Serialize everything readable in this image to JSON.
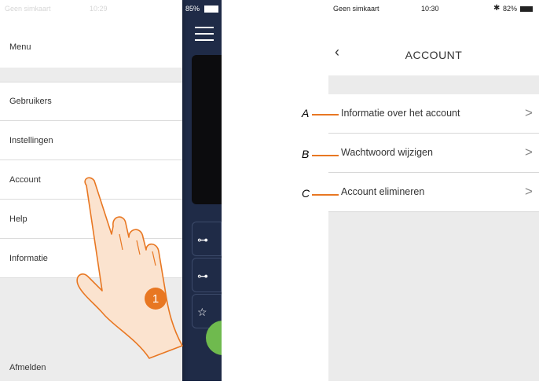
{
  "left_phone": {
    "status_bar": {
      "carrier": "Geen simkaart",
      "time": "10:29",
      "battery": "85%"
    },
    "drawer": {
      "title": "Menu",
      "items": [
        {
          "label": "Gebruikers"
        },
        {
          "label": "Instellingen"
        },
        {
          "label": "Account"
        },
        {
          "label": "Help"
        },
        {
          "label": "Informatie"
        }
      ],
      "logout_label": "Afmelden"
    },
    "step_badge": "1"
  },
  "right_phone": {
    "status_bar": {
      "carrier": "Geen simkaart",
      "time": "10:30",
      "battery": "82%"
    },
    "title": "ACCOUNT",
    "items": [
      {
        "label": "Informatie over het account",
        "annotation": "A"
      },
      {
        "label": "Wachtwoord wijzigen",
        "annotation": "B"
      },
      {
        "label": "Account elimineren",
        "annotation": "C"
      }
    ]
  },
  "colors": {
    "accent": "#e87722",
    "app_bg": "#1f2b47",
    "green": "#6fba4e"
  },
  "icons": [
    "hamburger-icon",
    "key-icon",
    "back-chevron-icon",
    "chevron-right-icon",
    "wifi-icon",
    "bluetooth-icon",
    "battery-icon"
  ]
}
